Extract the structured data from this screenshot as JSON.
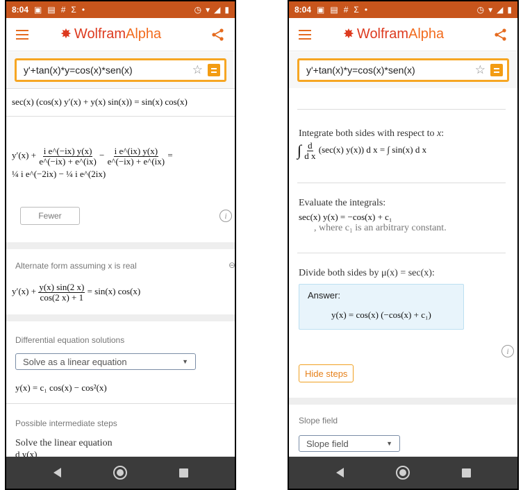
{
  "status": {
    "time": "8:04",
    "icons": [
      "image-icon",
      "calendar-icon",
      "grid-icon",
      "sigma-icon",
      "dot-icon"
    ],
    "right_icons": [
      "alarm-icon",
      "wifi-icon",
      "signal-icon",
      "battery-icon"
    ]
  },
  "app": {
    "brand": "WolframAlpha",
    "brand_part1": "Wolfram",
    "brand_part2": "Alpha"
  },
  "left": {
    "search": {
      "value": "y'+tan(x)*y=cos(x)*sen(x)"
    },
    "eq1": {
      "lhs": "sec(x) (cos(x) y′(x) + y(x) sin(x))",
      "rhs": "= sin(x) cos(x)"
    },
    "eq2": {
      "yprime": "y′(x) +",
      "f1_num": "i e^(−ix) y(x)",
      "f1_den": "e^(−ix) + e^(ix)",
      "minus": "−",
      "f2_num": "i e^(ix) y(x)",
      "f2_den": "e^(−ix) + e^(ix)",
      "equals": "=",
      "line2": "¼ i e^(−2ix) − ¼ i e^(2ix)"
    },
    "fewer_label": "Fewer",
    "alt_form": {
      "title": "Alternate form assuming x is real",
      "lhs": "y′(x) +",
      "frac_num": "y(x) sin(2 x)",
      "frac_den": "cos(2 x) + 1",
      "rhs": "= sin(x) cos(x)"
    },
    "de_solutions": {
      "title": "Differential equation solutions",
      "select_value": "Solve as a linear equation",
      "solution": "y(x) = c₁ cos(x) − cos²(x)"
    },
    "intermediate": {
      "title": "Possible intermediate steps",
      "text": "Solve the linear equation",
      "partial": "d y(x)"
    }
  },
  "right": {
    "search": {
      "value": "y'+tan(x)*y=cos(x)*sen(x)"
    },
    "step1": {
      "text_pre": "Integrate both sides with respect to ",
      "text_var": "x",
      "text_post": ":",
      "lhs": "(sec(x) y(x)) d x",
      "rhs": "= ∫ sin(x) d x",
      "frac_num": "d",
      "frac_den": "d x"
    },
    "step2": {
      "text": "Evaluate the integrals:",
      "eq": "sec(x) y(x) = −cos(x) + c₁",
      "note": ", where c₁ is an arbitrary constant."
    },
    "step3": {
      "text": "Divide both sides by μ(x) = sec(x):",
      "answer_label": "Answer:",
      "answer": "y(x) = cos(x) (−cos(x) + c₁)"
    },
    "hide_steps_label": "Hide steps",
    "slope": {
      "title": "Slope field",
      "select_value": "Slope field"
    }
  },
  "colors": {
    "status_bar": "#c8551c",
    "brand": "#dd3a1f",
    "search_border": "#f6a623",
    "answer_bg": "#e8f4fb",
    "nav_bar": "#3b3b3b"
  }
}
